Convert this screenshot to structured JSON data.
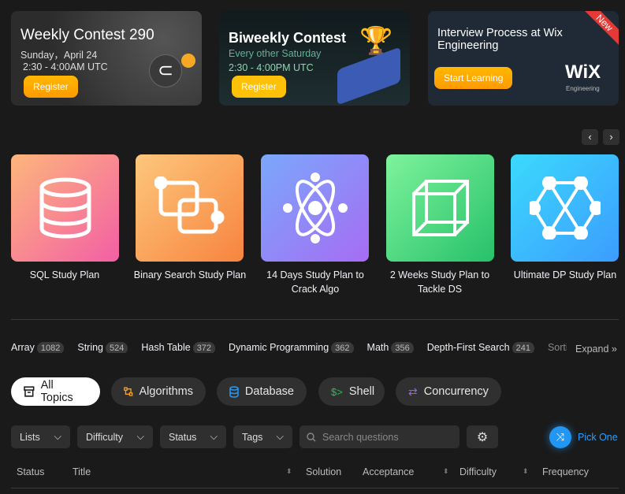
{
  "banners": [
    {
      "title": "Weekly Contest 290",
      "line1": "Sunday，April 24",
      "line2": "2:30 - 4:00AM UTC",
      "button": "Register"
    },
    {
      "title": "Biweekly Contest",
      "line1": "Every other Saturday",
      "line2": "2:30 - 4:00PM UTC",
      "button": "Register"
    },
    {
      "title": "Interview Process at Wix Engineering",
      "button": "Start Learning",
      "badge": "New",
      "logo": "WiX",
      "logo_sub": "Engineering"
    }
  ],
  "carousel": {
    "prev": "‹",
    "next": "›"
  },
  "study_plans": [
    {
      "label": "SQL Study Plan",
      "icon": "database-icon",
      "gradient": [
        "#fdb67c",
        "#f35fa5"
      ]
    },
    {
      "label": "Binary Search Study Plan",
      "icon": "overlap-squares-icon",
      "gradient": [
        "#fdc77c",
        "#f7843f"
      ]
    },
    {
      "label": "14 Days Study Plan to Crack Algo",
      "icon": "atom-icon",
      "gradient": [
        "#7aa8fb",
        "#a66cf4"
      ]
    },
    {
      "label": "2 Weeks Study Plan to Tackle DS",
      "icon": "cube-icon",
      "gradient": [
        "#7ef39c",
        "#27c16a"
      ]
    },
    {
      "label": "Ultimate DP Study Plan",
      "icon": "graph-icon",
      "gradient": [
        "#3bdafc",
        "#3c9cff"
      ]
    }
  ],
  "tags": [
    {
      "name": "Array",
      "count": "1082"
    },
    {
      "name": "String",
      "count": "524"
    },
    {
      "name": "Hash Table",
      "count": "372"
    },
    {
      "name": "Dynamic Programming",
      "count": "362"
    },
    {
      "name": "Math",
      "count": "356"
    },
    {
      "name": "Depth-First Search",
      "count": "241"
    },
    {
      "name": "Sorting",
      "count": ""
    }
  ],
  "expand": "Expand",
  "topics": [
    {
      "label": "All Topics",
      "icon": "archive-icon",
      "color": "#1a1a1a"
    },
    {
      "label": "Algorithms",
      "icon": "algorithm-icon",
      "color": "#ffa116"
    },
    {
      "label": "Database",
      "icon": "database-icon",
      "color": "#2196f3"
    },
    {
      "label": "Shell",
      "icon": "shell-icon",
      "color": "#2cbb5d"
    },
    {
      "label": "Concurrency",
      "icon": "concurrency-icon",
      "color": "#a855f7"
    }
  ],
  "filters": {
    "lists": "Lists",
    "difficulty": "Difficulty",
    "status": "Status",
    "tags": "Tags",
    "search_placeholder": "Search questions",
    "pick_one": "Pick One"
  },
  "table_headers": {
    "status": "Status",
    "title": "Title",
    "solution": "Solution",
    "acceptance": "Acceptance",
    "difficulty": "Difficulty",
    "frequency": "Frequency"
  }
}
